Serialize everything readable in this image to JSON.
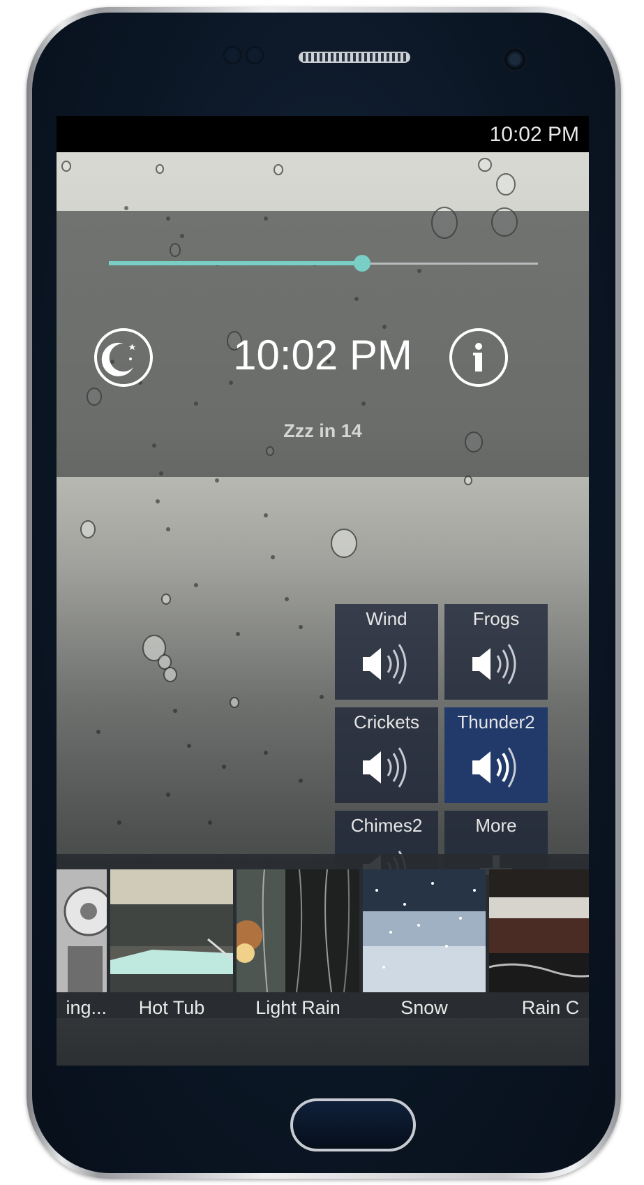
{
  "status_bar": {
    "time": "10:02 PM"
  },
  "timer": {
    "clock": "10:02 PM",
    "countdown": "Zzz in 14",
    "volume_level": 0.59
  },
  "sound_tiles": [
    {
      "label": "Wind",
      "icon": "speaker-icon",
      "active": false
    },
    {
      "label": "Frogs",
      "icon": "speaker-icon",
      "active": false
    },
    {
      "label": "Crickets",
      "icon": "speaker-icon",
      "active": false
    },
    {
      "label": "Thunder2",
      "icon": "speaker-icon",
      "active": true
    },
    {
      "label": "Chimes2",
      "icon": "speaker-icon",
      "active": false
    },
    {
      "label": "More",
      "icon": "plus-icon",
      "active": false
    }
  ],
  "scenes": [
    {
      "label": "ing..."
    },
    {
      "label": "Hot Tub"
    },
    {
      "label": "Light Rain"
    },
    {
      "label": "Snow"
    },
    {
      "label": "Rain C"
    }
  ],
  "colors": {
    "accent": "#79cfc5",
    "active_tile": "#213a6a",
    "tile": "#1e2537"
  }
}
